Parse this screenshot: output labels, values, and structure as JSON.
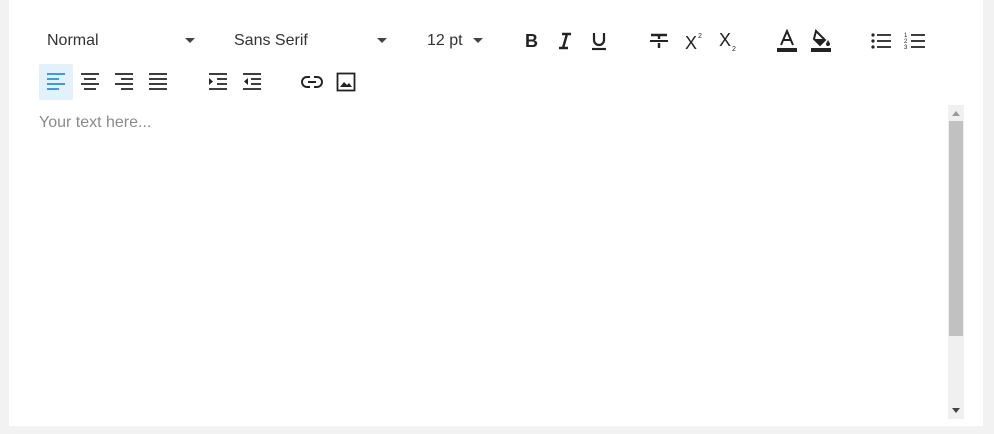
{
  "toolbar": {
    "paragraph_style": "Normal",
    "font_family": "Sans Serif",
    "font_size": "12 pt"
  },
  "editor": {
    "placeholder": "Your text here..."
  },
  "colors": {
    "accent": "#2a8fd6",
    "active_bg": "#e3f1fb",
    "icon": "#222222"
  },
  "icons": [
    "bold-icon",
    "italic-icon",
    "underline-icon",
    "strikethrough-icon",
    "superscript-icon",
    "subscript-icon",
    "text-color-icon",
    "highlight-color-icon",
    "bulleted-list-icon",
    "numbered-list-icon",
    "align-left-icon",
    "align-center-icon",
    "align-right-icon",
    "align-justify-icon",
    "indent-increase-icon",
    "indent-decrease-icon",
    "link-icon",
    "image-icon"
  ]
}
